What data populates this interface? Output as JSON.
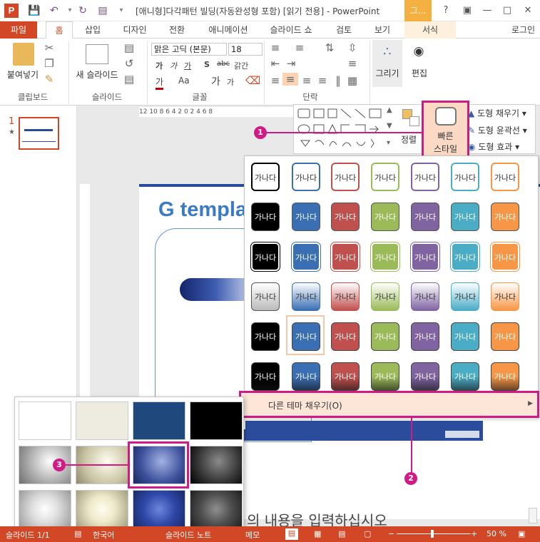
{
  "window": {
    "title": "[애니형]다각패턴 빌딩(자동완성형 포함) [읽기 전용] - PowerPoint",
    "context_group": "그...",
    "help": "?",
    "signin": "로그인"
  },
  "tabs": [
    {
      "label": "파일"
    },
    {
      "label": "홈"
    },
    {
      "label": "삽입"
    },
    {
      "label": "디자인"
    },
    {
      "label": "전환"
    },
    {
      "label": "애니메이션"
    },
    {
      "label": "슬라이드 쇼"
    },
    {
      "label": "검토"
    },
    {
      "label": "보기"
    },
    {
      "label": "서식"
    }
  ],
  "ribbon": {
    "clipboard": {
      "paste": "붙여넣기",
      "group": "클립보드"
    },
    "slides": {
      "new_slide": "새 슬라이드",
      "group": "슬라이드"
    },
    "font": {
      "name": "맑은 고딕 (본문)",
      "size": "18",
      "group": "글꼴",
      "bold": "가",
      "italic": "가",
      "underline": "가",
      "shadow": "S",
      "strike": "abc",
      "spacing": "갉간",
      "font_color": "가",
      "case": "Aa",
      "grow": "가",
      "shrink": "가"
    },
    "paragraph": {
      "group": "단락"
    },
    "drawing": {
      "arrange": "정렬",
      "quick_styles_line1": "빠른",
      "quick_styles_line2": "스타일",
      "shape_fill": "도형 채우기",
      "shape_outline": "도형 윤곽선",
      "shape_effects": "도형 효과"
    },
    "drawing_tool": {
      "label": "그리기"
    },
    "editing": {
      "label": "편집"
    }
  },
  "ruler_text": "12 10 8 6 4 2 0 2 4 6 8",
  "slide": {
    "number": "1",
    "title": "G templa",
    "notes": "의 내용을 입력하십시오"
  },
  "style_gallery": {
    "swatch_text": "가나다",
    "more_fills": "다른 테마 채우기(O)",
    "more_fills_arrow": "▶"
  },
  "callouts": [
    "1",
    "2",
    "3"
  ],
  "status": {
    "slide": "슬라이드 1/1",
    "lang": "한국어",
    "notes": "슬라이드 노트",
    "comments": "메모",
    "zoom": "50 %"
  },
  "colors": {
    "accent": "#d24726",
    "highlight": "#d01a86"
  }
}
